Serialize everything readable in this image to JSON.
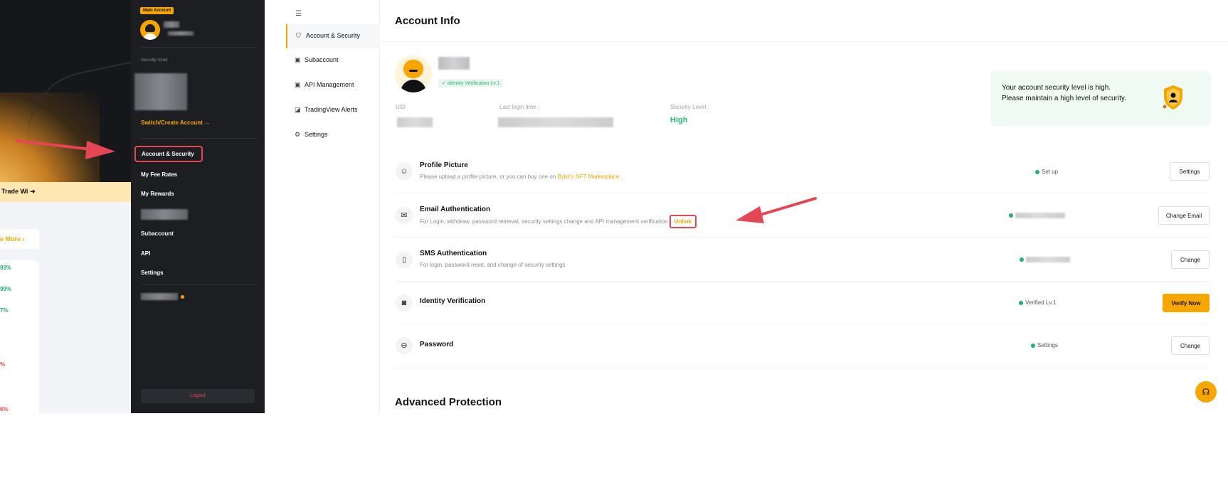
{
  "background": {
    "trade_banner": "Trade Wi",
    "more_label": "e More ›",
    "percentages": [
      {
        "text": "03%",
        "color": "#20b26c"
      },
      {
        "text": "99%",
        "color": "#20b26c"
      },
      {
        "text": "7%",
        "color": "#20b26c"
      },
      {
        "text": "%",
        "color": "#e64653"
      },
      {
        "text": "6%",
        "color": "#e64653"
      }
    ]
  },
  "menu": {
    "badge": "Main Account",
    "security_label": "Security Used",
    "switch_label": "Switch/Create Account →",
    "items": [
      {
        "label": "Account & Security"
      },
      {
        "label": "My Fee Rates"
      },
      {
        "label": "My Rewards"
      },
      {
        "label": "Subaccount"
      },
      {
        "label": "API"
      },
      {
        "label": "Settings"
      }
    ],
    "logout_label": "Logout"
  },
  "subnav": {
    "collapse_icon": "collapse-icon",
    "items": [
      {
        "label": "Account & Security",
        "icon": "shield-icon",
        "glyph": "⛉",
        "active": true
      },
      {
        "label": "Subaccount",
        "icon": "subaccount-icon",
        "glyph": "▣",
        "active": false
      },
      {
        "label": "API Management",
        "icon": "api-icon",
        "glyph": "▣",
        "active": false
      },
      {
        "label": "TradingView Alerts",
        "icon": "alert-icon",
        "glyph": "◪",
        "active": false
      },
      {
        "label": "Settings",
        "icon": "gear-icon",
        "glyph": "⚙",
        "active": false
      }
    ]
  },
  "account": {
    "title": "Account Info",
    "verification_badge": "Identity Verification Lv.1",
    "uid_label": "UID",
    "last_login_label": "Last login time :",
    "security_level_label": "Security Level :",
    "security_level_value": "High",
    "security_message_line1": "Your account security level is high.",
    "security_message_line2": "Please maintain a high level of security."
  },
  "rows": [
    {
      "title": "Profile Picture",
      "icon": "user-circle-icon",
      "glyph": "☺",
      "desc_prefix": "Please upload a profile picture, or you can buy one on ",
      "desc_link": "Bybit's NFT Marketplace",
      "desc_suffix": " .",
      "status": "Set up",
      "button": "Settings"
    },
    {
      "title": "Email Authentication",
      "icon": "mail-icon",
      "glyph": "✉",
      "desc_prefix": "For Login, withdraw, password retrieval, security settings change and API management verification",
      "unlink": "Unlink",
      "status": "",
      "button": "Change Email"
    },
    {
      "title": "SMS Authentication",
      "icon": "phone-icon",
      "glyph": "▯",
      "desc_prefix": "For login, password reset, and change of security settings",
      "status": "",
      "button": "Change"
    },
    {
      "title": "Identity Verification",
      "icon": "id-card-icon",
      "glyph": "◙",
      "status": "Verified Lv.1",
      "button": "Verify Now"
    },
    {
      "title": "Password",
      "icon": "lock-icon",
      "glyph": "⊖",
      "status": "Settings",
      "button": "Change"
    }
  ],
  "advanced_title": "Advanced Protection",
  "support_icon": "headset-icon",
  "colors": {
    "accent": "#f7a600",
    "success": "#20b26c",
    "highlight": "#e64653",
    "menu_bg": "#1d1e22"
  }
}
